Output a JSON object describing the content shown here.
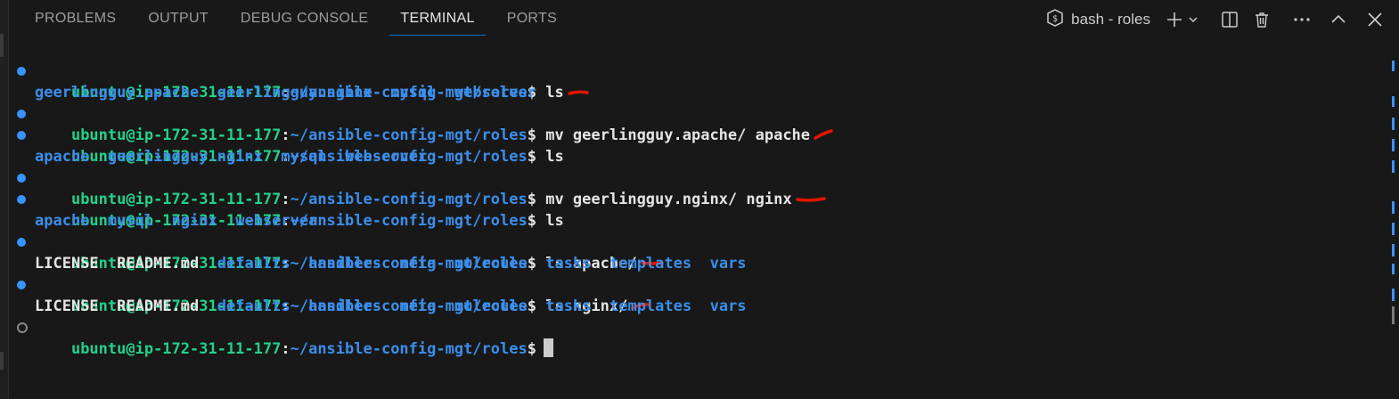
{
  "tabs": [
    {
      "label": "PROBLEMS",
      "active": false
    },
    {
      "label": "OUTPUT",
      "active": false
    },
    {
      "label": "DEBUG CONSOLE",
      "active": false
    },
    {
      "label": "TERMINAL",
      "active": true
    },
    {
      "label": "PORTS",
      "active": false
    }
  ],
  "actions": {
    "terminal_name": "bash - roles",
    "icons": [
      "terminal-icon",
      "new-terminal-plus-icon",
      "launch-profile-chevron-icon",
      "split-terminal-icon",
      "kill-terminal-trash-icon",
      "more-actions-ellipsis-icon",
      "maximize-panel-chevron-up-icon",
      "close-panel-icon"
    ]
  },
  "prompt": {
    "user_host": "ubuntu@ip-172-31-11-177",
    "colon": ":",
    "path": "~/ansible-config-mgt/roles",
    "dollar": "$"
  },
  "terminal": {
    "cmd1": "ls",
    "out1": [
      "geerlingguy.apache",
      "geerlingguy.nginx",
      "mysql",
      "webserver"
    ],
    "cmd2": "mv geerlingguy.apache/ apache",
    "cmd3": "ls",
    "out3": [
      "apache",
      "geerlingguy.nginx",
      "mysql",
      "webserver"
    ],
    "cmd4": "mv geerlingguy.nginx/ nginx",
    "cmd5": "ls",
    "out5": [
      "apache",
      "mysql",
      "nginx",
      "webserver"
    ],
    "cmd6": "ls apache/",
    "out6_files": [
      "LICENSE",
      "README.md"
    ],
    "out6_dirs": [
      "defaults",
      "handlers",
      "meta",
      "molecule",
      "tasks",
      "templates",
      "vars"
    ],
    "cmd7": "ls nginx/",
    "out7_files": [
      "LICENSE",
      "README.md"
    ],
    "out7_dirs": [
      "defaults",
      "handlers",
      "meta",
      "molecule",
      "tasks",
      "templates",
      "vars"
    ]
  },
  "colors": {
    "background": "#181818",
    "prompt_user": "#23d18b",
    "prompt_path": "#3b8eea",
    "directory": "#3b8eea",
    "annotation": "#e51400",
    "active_tab_underline": "#0078d4"
  }
}
